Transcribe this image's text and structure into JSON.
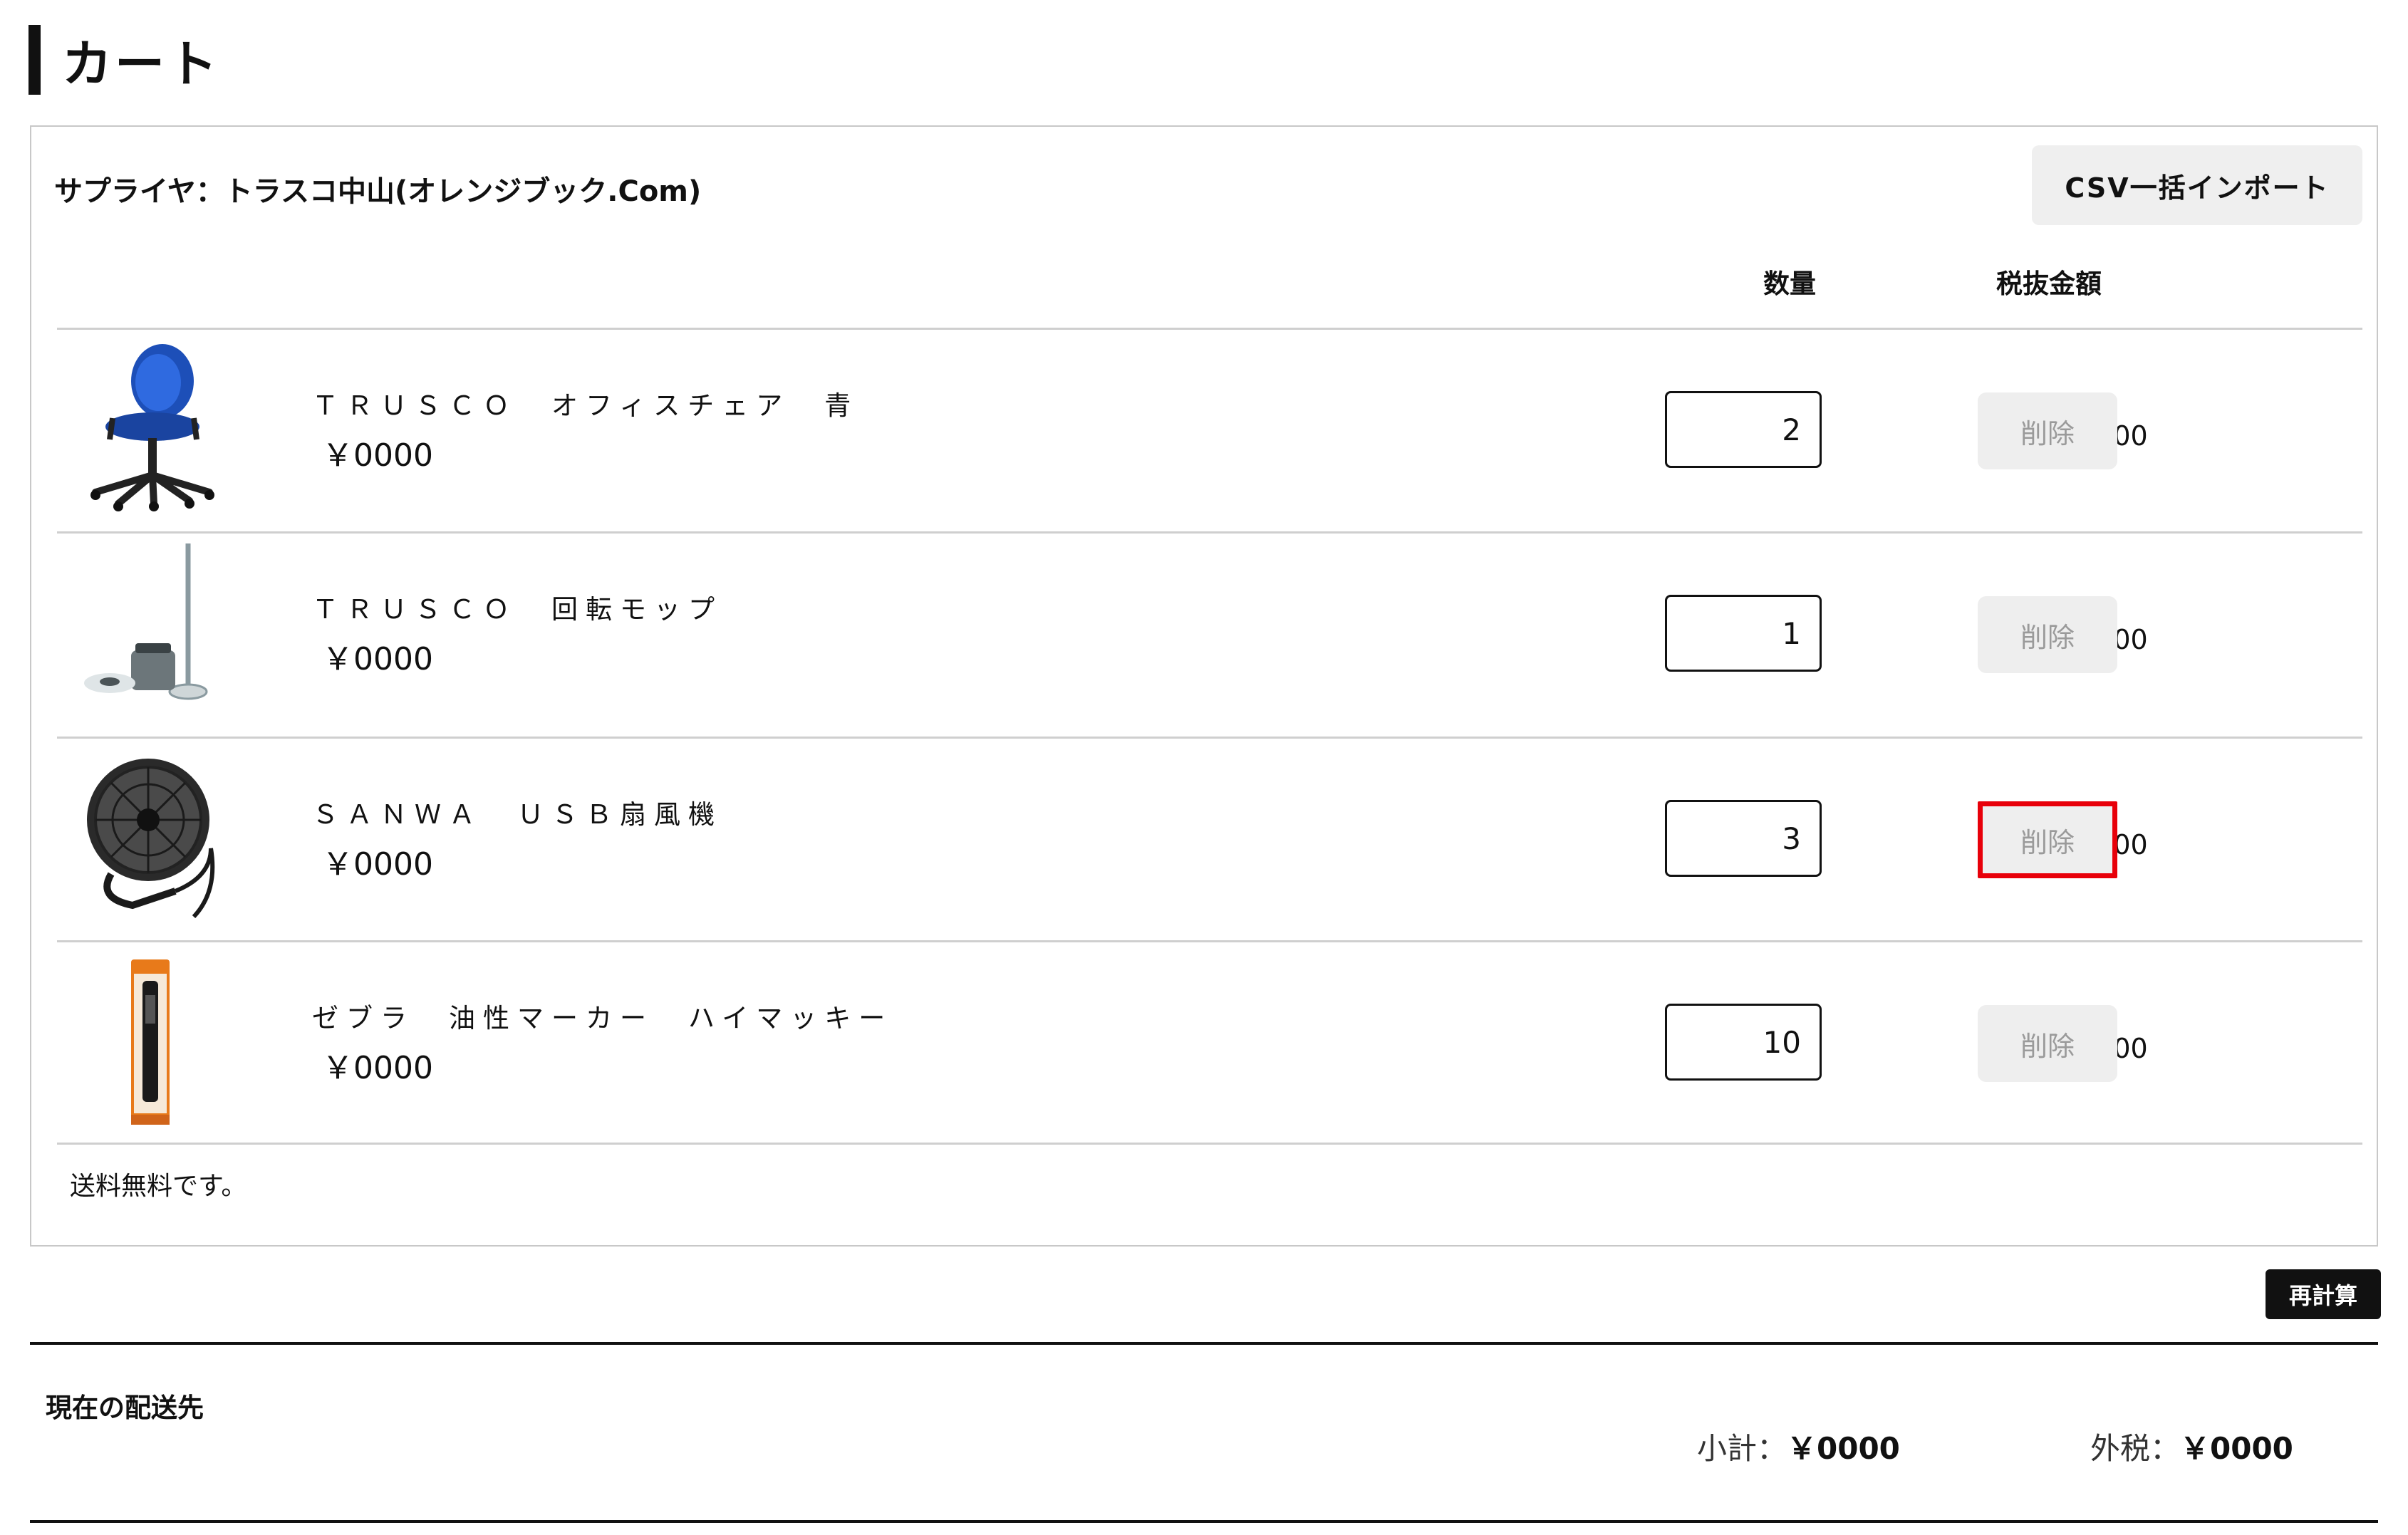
{
  "page": {
    "title": "カート"
  },
  "supplier": {
    "label": "サプライヤ：トラスコ中山(オレンジブック.Com)"
  },
  "actions": {
    "csv_import": "CSV一括インポート",
    "recalculate": "再計算",
    "delete": "削除"
  },
  "table": {
    "headers": {
      "quantity": "数量",
      "price_excl_tax": "税抜金額"
    },
    "items": [
      {
        "name": "ＴＲＵＳＣＯ　オフィスチェア　青",
        "unit_price": "￥0000",
        "quantity": "2",
        "line_total": "￥0000",
        "icon": "office-chair-image"
      },
      {
        "name": "ＴＲＵＳＣＯ　回転モップ",
        "unit_price": "￥0000",
        "quantity": "1",
        "line_total": "￥0000",
        "icon": "spin-mop-image"
      },
      {
        "name": "ＳＡＮＷＡ　ＵＳＢ扇風機",
        "unit_price": "￥0000",
        "quantity": "3",
        "line_total": "￥0000",
        "icon": "usb-fan-image"
      },
      {
        "name": "ゼブラ　油性マーカー　ハイマッキー",
        "unit_price": "￥0000",
        "quantity": "10",
        "line_total": "￥0000",
        "icon": "marker-package-image"
      }
    ]
  },
  "shipping_note": "送料無料です。",
  "delivery": {
    "current_destination_label": "現在の配送先"
  },
  "summary": {
    "subtotal_label": "小計：",
    "subtotal_value": "￥0000",
    "tax_label": "外税：",
    "tax_value": "￥0000"
  },
  "colors": {
    "highlight": "#e8000a",
    "button_gray": "#eeeeee",
    "dark": "#111111"
  }
}
